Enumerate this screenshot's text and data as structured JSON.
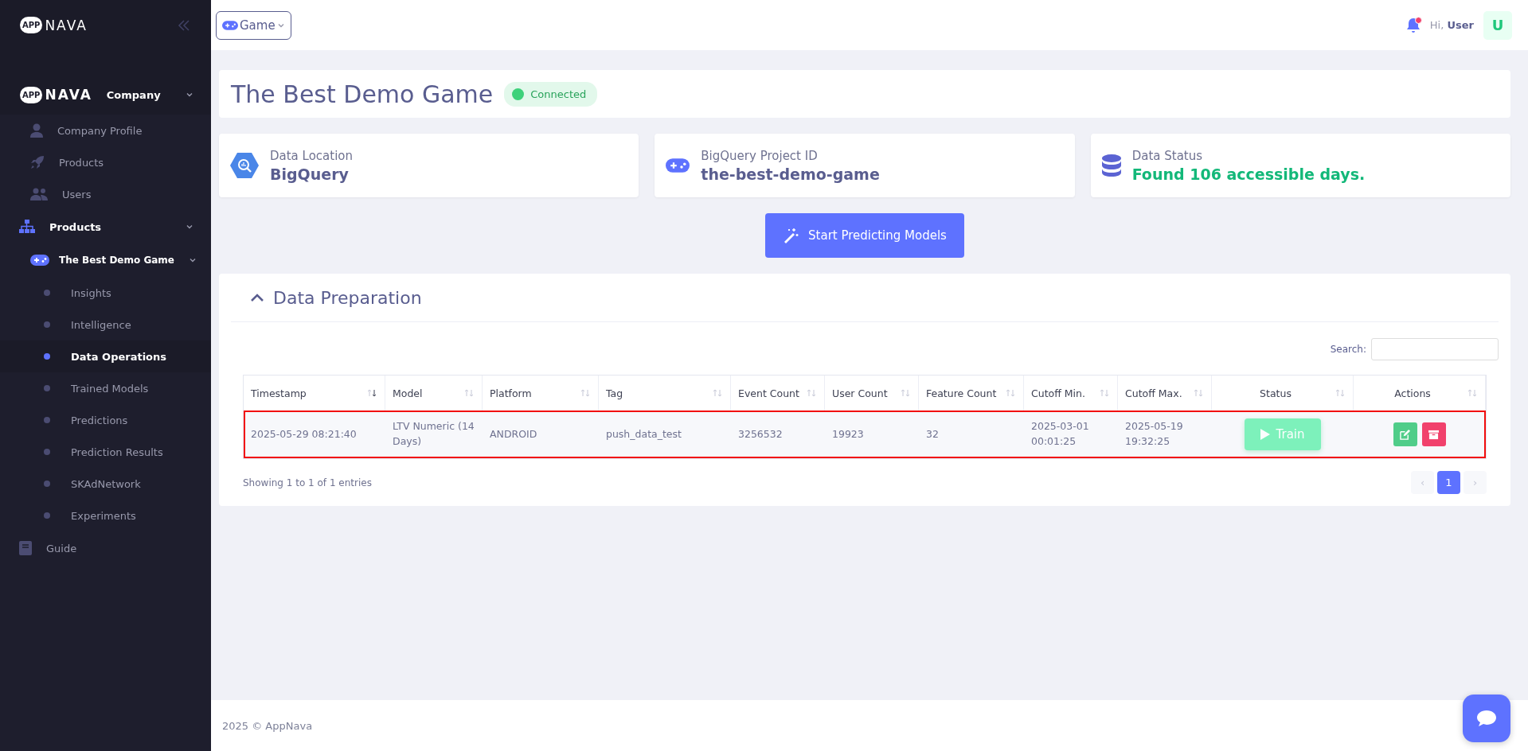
{
  "sidebar": {
    "logo": {
      "badge": "APP",
      "word": "NAVA"
    },
    "nav": [
      {
        "kind": "company",
        "logo": {
          "badge": "APP",
          "word": "NAVA"
        },
        "label": "Company",
        "expanded": true,
        "children": [
          {
            "label": "Company Profile"
          },
          {
            "label": "Products"
          },
          {
            "label": "Users"
          }
        ]
      },
      {
        "kind": "group",
        "label": "Products",
        "expanded": true,
        "children": [
          {
            "label": "The Best Demo Game",
            "expanded": true,
            "children": [
              {
                "label": "Insights",
                "selected": false
              },
              {
                "label": "Intelligence",
                "selected": false
              },
              {
                "label": "Data Operations",
                "selected": true
              },
              {
                "label": "Trained Models",
                "selected": false
              },
              {
                "label": "Predictions",
                "selected": false
              },
              {
                "label": "Prediction Results",
                "selected": false
              },
              {
                "label": "SKAdNetwork",
                "selected": false
              },
              {
                "label": "Experiments",
                "selected": false
              }
            ]
          }
        ]
      },
      {
        "kind": "link",
        "label": "Guide"
      }
    ]
  },
  "topbar": {
    "selector": "Game",
    "greeting": "Hi,",
    "user": "User",
    "avatar": "U",
    "notification": true
  },
  "header": {
    "title": "The Best Demo Game",
    "status": "Connected"
  },
  "info_cards": [
    {
      "label": "Data Location",
      "value": "BigQuery",
      "kind": "location"
    },
    {
      "label": "BigQuery Project ID",
      "value": "the-best-demo-game",
      "kind": "project"
    },
    {
      "label": "Data Status",
      "value": "Found 106 accessible days.",
      "kind": "status"
    }
  ],
  "primary_button": "Start Predicting Models",
  "data_preparation": {
    "title": "Data Preparation",
    "expanded": true,
    "search_label": "Search:",
    "table": {
      "columns": [
        {
          "label": "Timestamp",
          "sorted": true
        },
        {
          "label": "Model",
          "sorted": false
        },
        {
          "label": "Platform",
          "sorted": false
        },
        {
          "label": "Tag",
          "sorted": false
        },
        {
          "label": "Event Count",
          "sorted": false
        },
        {
          "label": "User Count",
          "sorted": false
        },
        {
          "label": "Feature Count",
          "sorted": false
        },
        {
          "label": "Cutoff Min.",
          "sorted": false
        },
        {
          "label": "Cutoff Max.",
          "sorted": false
        },
        {
          "label": "Status",
          "sorted": false
        },
        {
          "label": "Actions",
          "sorted": false
        }
      ],
      "rows": [
        {
          "highlighted": true,
          "cells": [
            "2025-05-29 08:21:40",
            "LTV Numeric (14 Days)",
            "ANDROID",
            "push_data_test",
            "3256532",
            "19923",
            "32",
            "2025-03-01 00:01:25",
            "2025-05-19 19:32:25"
          ],
          "train": {
            "label": "Train",
            "disabled": true
          }
        }
      ]
    },
    "info": "Showing 1 to 1 of 1 entries",
    "pagination": {
      "prev": {
        "label": "‹",
        "disabled": true
      },
      "pages": [
        {
          "label": "1",
          "selected": true
        }
      ],
      "next": {
        "label": "›",
        "disabled": true
      }
    }
  },
  "footer": "2025 © AppNava"
}
